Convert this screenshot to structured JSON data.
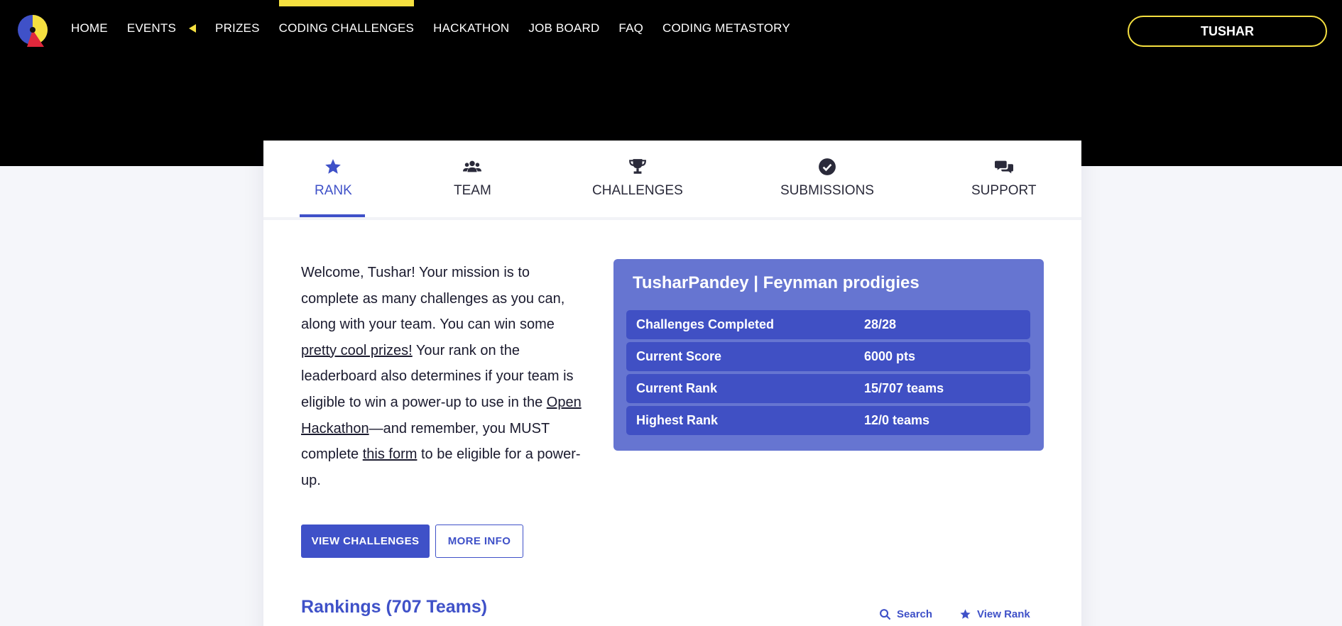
{
  "nav": {
    "items": [
      {
        "label": "HOME"
      },
      {
        "label": "EVENTS"
      },
      {
        "label": "PRIZES"
      },
      {
        "label": "CODING CHALLENGES"
      },
      {
        "label": "HACKATHON"
      },
      {
        "label": "JOB BOARD"
      },
      {
        "label": "FAQ"
      },
      {
        "label": "CODING METASTORY"
      }
    ],
    "active": "CODING CHALLENGES",
    "user_label": "TUSHAR"
  },
  "tabs": [
    {
      "label": "RANK",
      "icon": "star-icon"
    },
    {
      "label": "TEAM",
      "icon": "users-icon"
    },
    {
      "label": "CHALLENGES",
      "icon": "trophy-icon"
    },
    {
      "label": "SUBMISSIONS",
      "icon": "check-circle-icon"
    },
    {
      "label": "SUPPORT",
      "icon": "chat-icon"
    }
  ],
  "welcome": {
    "part1": "Welcome, Tushar! Your mission is to complete as many challenges as you can, along with your team. You can win some ",
    "link1": "pretty cool prizes!",
    "part2": " Your rank on the leaderboard also determines if your team is eligible to win a power-up to use in the ",
    "link2": "Open Hackathon",
    "part3": "—and remember, you MUST complete ",
    "link3": "this form",
    "part4": " to be eligible for a power-up."
  },
  "buttons": {
    "view_challenges": "VIEW CHALLENGES",
    "more_info": "MORE INFO"
  },
  "stats": {
    "title": "TusharPandey | Feynman prodigies",
    "rows": [
      {
        "label": "Challenges Completed",
        "value": "28/28"
      },
      {
        "label": "Current Score",
        "value": "6000 pts"
      },
      {
        "label": "Current Rank",
        "value": "15/707 teams"
      },
      {
        "label": "Highest Rank",
        "value": "12/0 teams"
      }
    ]
  },
  "rankings": {
    "title": "Rankings (707 Teams)",
    "search_label": "Search",
    "view_rank_label": "View Rank"
  },
  "colors": {
    "accent": "#3f51c8",
    "highlight": "#f5e040",
    "stats_bg": "#6675d1"
  }
}
